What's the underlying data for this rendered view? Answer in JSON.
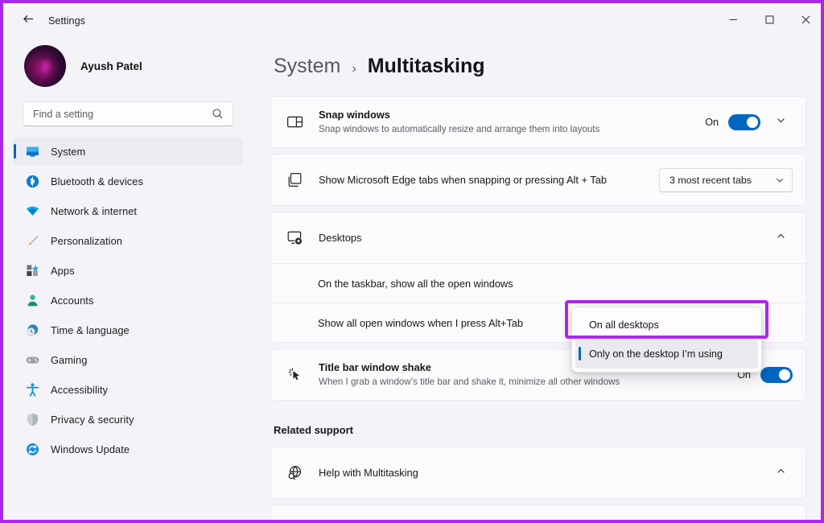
{
  "window": {
    "app_title": "Settings",
    "back_icon": "back-arrow-icon",
    "controls": {
      "minimize": "minimize-icon",
      "maximize": "maximize-icon",
      "close": "close-icon"
    }
  },
  "colors": {
    "annotation": "#ab28ea",
    "accent": "#0067c0",
    "selection_bar": "#0066b4",
    "page_bg": "#f3f3f8",
    "card_bg": "#fbfbfd"
  },
  "sidebar": {
    "profile": {
      "name": "Ayush Patel",
      "avatar": "user-avatar"
    },
    "search": {
      "placeholder": "Find a setting",
      "value": "",
      "icon": "search-icon"
    },
    "items": [
      {
        "label": "System",
        "icon": "monitor-icon",
        "active": true
      },
      {
        "label": "Bluetooth & devices",
        "icon": "bluetooth-icon",
        "active": false
      },
      {
        "label": "Network & internet",
        "icon": "wifi-icon",
        "active": false
      },
      {
        "label": "Personalization",
        "icon": "paintbrush-icon",
        "active": false
      },
      {
        "label": "Apps",
        "icon": "apps-grid-icon",
        "active": false
      },
      {
        "label": "Accounts",
        "icon": "person-icon",
        "active": false
      },
      {
        "label": "Time & language",
        "icon": "clock-globe-icon",
        "active": false
      },
      {
        "label": "Gaming",
        "icon": "gamepad-icon",
        "active": false
      },
      {
        "label": "Accessibility",
        "icon": "accessibility-person-icon",
        "active": false
      },
      {
        "label": "Privacy & security",
        "icon": "shield-icon",
        "active": false
      },
      {
        "label": "Windows Update",
        "icon": "update-refresh-icon",
        "active": false
      }
    ]
  },
  "breadcrumb": {
    "parent": "System",
    "separator": "›",
    "current": "Multitasking"
  },
  "main": {
    "snap": {
      "title": "Snap windows",
      "desc": "Snap windows to automatically resize and arrange them into layouts",
      "icon": "snap-layout-icon",
      "toggle_state": "On",
      "expand_icon": "chevron-down-icon"
    },
    "edge_tabs": {
      "title": "Show Microsoft Edge tabs when snapping or pressing Alt + Tab",
      "icon": "window-stack-icon",
      "combo_value": "3 most recent tabs",
      "combo_icon": "chevron-down-icon"
    },
    "desktops": {
      "title": "Desktops",
      "icon": "desktop-add-icon",
      "collapse_icon": "chevron-up-icon",
      "rows": [
        {
          "label": "On the taskbar, show all the open windows"
        },
        {
          "label": "Show all open windows when I press Alt+Tab"
        }
      ]
    },
    "shake": {
      "title": "Title bar window shake",
      "desc": "When I grab a window’s title bar and shake it, minimize all other windows",
      "icon": "cursor-shake-icon",
      "toggle_state": "On"
    },
    "related_support": {
      "heading": "Related support",
      "help": {
        "title": "Help with Multitasking",
        "icon": "globe-search-icon",
        "collapse_icon": "chevron-up-icon"
      }
    }
  },
  "dropdown": {
    "open": true,
    "options": [
      {
        "label": "On all desktops",
        "highlighted": true,
        "selected": false
      },
      {
        "label": "Only on the desktop I’m using",
        "highlighted": false,
        "selected": true
      }
    ]
  }
}
